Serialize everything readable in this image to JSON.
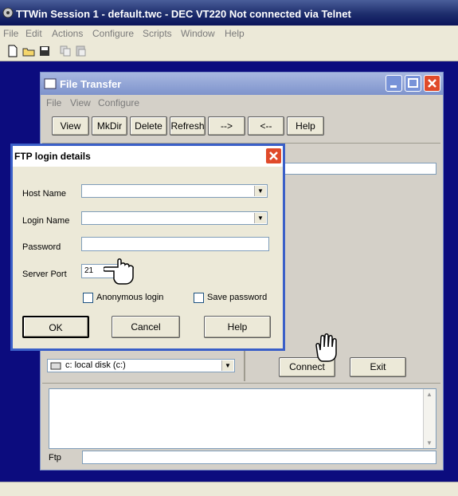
{
  "main_window": {
    "title": "TTWin Session 1 - default.twc - DEC VT220 Not connected via Telnet",
    "menu": [
      "File",
      "Edit",
      "Actions",
      "Configure",
      "Scripts",
      "Window",
      "Help"
    ]
  },
  "file_transfer": {
    "title": "File Transfer",
    "menu": [
      "File",
      "View",
      "Configure"
    ],
    "toolbar": [
      "View",
      "MkDir",
      "Delete",
      "Refresh",
      "-->",
      "<--",
      "Help"
    ],
    "drive_select": "c: local disk (c:)",
    "connect_label": "Connect",
    "exit_label": "Exit",
    "ftp_label": "Ftp"
  },
  "ftp_dialog": {
    "title": "FTP login details",
    "host_label": "Host Name",
    "host_value": "",
    "login_label": "Login Name",
    "login_value": "",
    "password_label": "Password",
    "password_value": "",
    "port_label": "Server Port",
    "port_value": "21",
    "anonymous_label": "Anonymous login",
    "anonymous_checked": false,
    "save_password_label": "Save password",
    "save_password_checked": false,
    "ok_label": "OK",
    "cancel_label": "Cancel",
    "help_label": "Help"
  },
  "colors": {
    "desktop": "#0c0c7e",
    "dialog_border": "#3a5fc8",
    "close_red": "#e04a2a"
  }
}
